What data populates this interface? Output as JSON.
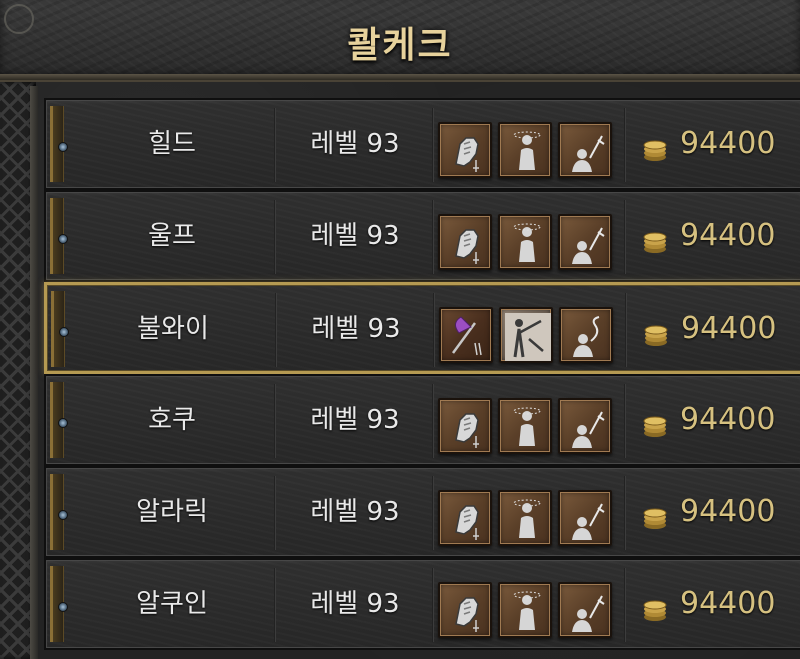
{
  "header": {
    "title": "콸케크"
  },
  "colors": {
    "gold_text": "#d6c180",
    "title_text": "#e7d29c",
    "selected_border": "#b59a52",
    "row_bg": "#2b2b2b"
  },
  "rows": [
    {
      "name": "힐드",
      "level": "레벨 93",
      "price": "94400",
      "selected": false,
      "skills": [
        "fist-skill-icon",
        "dizzy-figure-skill-icon",
        "sword-figure-skill-icon"
      ]
    },
    {
      "name": "울프",
      "level": "레벨 93",
      "price": "94400",
      "selected": false,
      "skills": [
        "fist-skill-icon",
        "dizzy-figure-skill-icon",
        "sword-figure-skill-icon"
      ]
    },
    {
      "name": "불와이",
      "level": "레벨 93",
      "price": "94400",
      "selected": true,
      "skills": [
        "purple-axe-skill-icon",
        "arrow-pose-skill-icon",
        "whip-figure-skill-icon"
      ]
    },
    {
      "name": "호쿠",
      "level": "레벨 93",
      "price": "94400",
      "selected": false,
      "skills": [
        "fist-skill-icon",
        "dizzy-figure-skill-icon",
        "sword-figure-skill-icon"
      ]
    },
    {
      "name": "알라릭",
      "level": "레벨 93",
      "price": "94400",
      "selected": false,
      "skills": [
        "fist-skill-icon",
        "dizzy-figure-skill-icon",
        "sword-figure-skill-icon"
      ]
    },
    {
      "name": "알쿠인",
      "level": "레벨 93",
      "price": "94400",
      "selected": false,
      "skills": [
        "fist-skill-icon",
        "dizzy-figure-skill-icon",
        "sword-figure-skill-icon"
      ]
    }
  ]
}
